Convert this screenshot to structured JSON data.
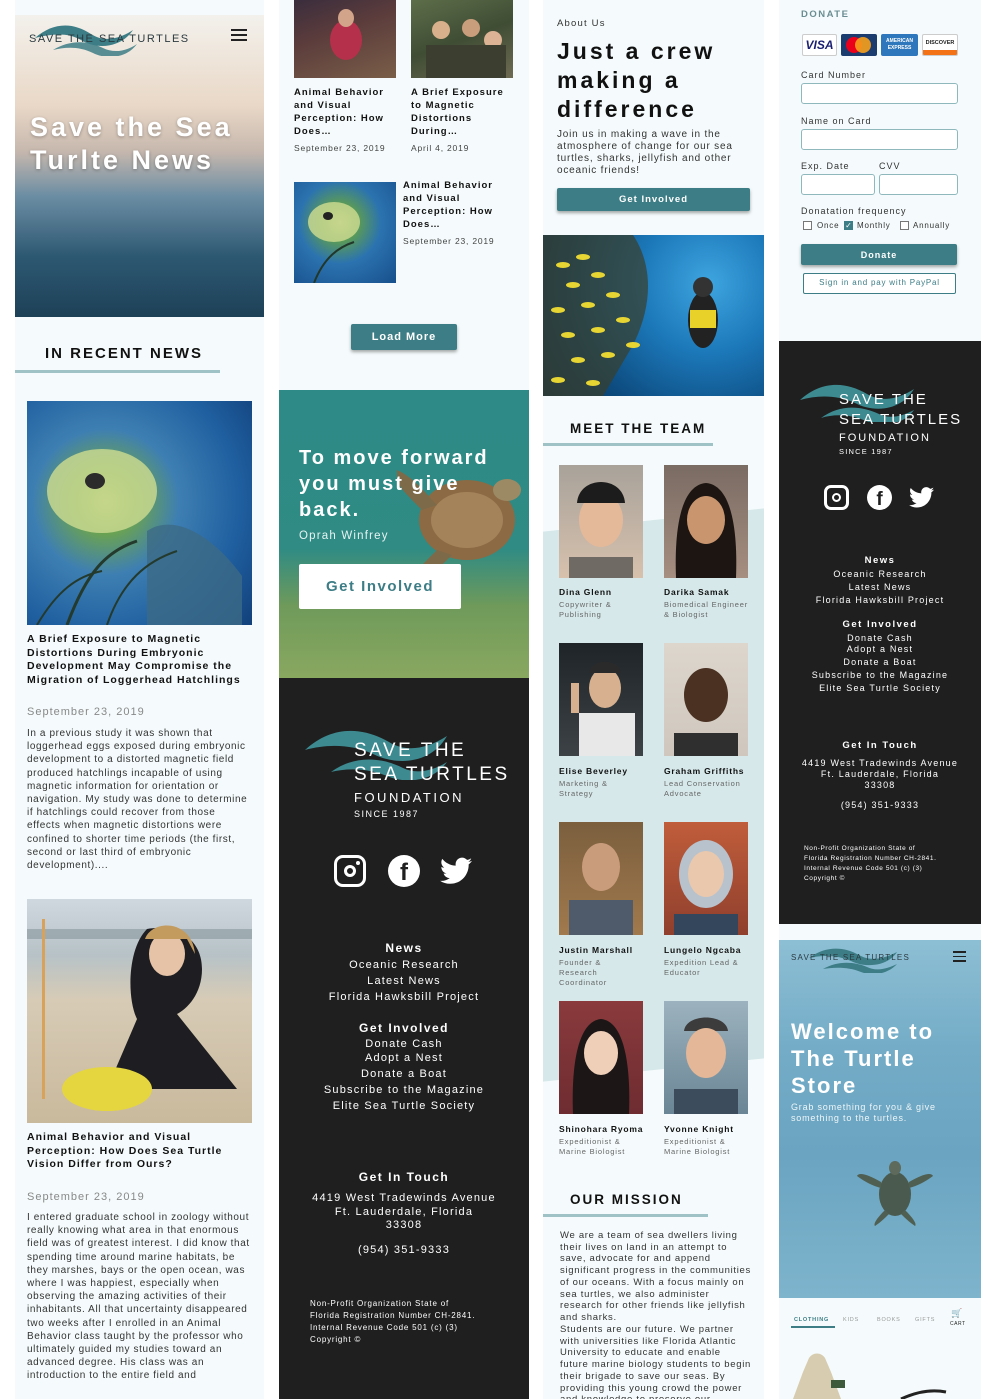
{
  "colors": {
    "accent": "#3d7d86",
    "footer_bg": "#1f1f1f",
    "light_bg": "#f5fbfc"
  },
  "col1": {
    "logo": "SAVE THE SEA TURTLES",
    "hero_title": "Save the Sea Turlte News",
    "section_title": "IN RECENT NEWS",
    "articles": [
      {
        "title": "A Brief Exposure to Magnetic Distortions During Embryonic Development May Compromise the Migration of Loggerhead Hatchlings",
        "date": "September 23, 2019",
        "body": "In a previous study it was shown that loggerhead eggs exposed during embryonic development to a distorted magnetic field produced hatchlings incapable of using magnetic information for orientation or navigation. My study was done to determine if hatchlings could recover from those effects when magnetic distortions were confined to shorter time periods (the first, second or last third of embryonic development)...."
      },
      {
        "title": "Animal Behavior and Visual Perception: How Does Sea Turtle Vision Differ from Ours?",
        "date": "September 23, 2019",
        "body": "I entered graduate school in zoology without really knowing what area in that enormous field was of greatest interest. I did know that spending time around marine habitats, be they marshes, bays or the open ocean, was where I was happiest, especially when observing the amazing activities of their inhabitants. All that uncertainty disappeared two weeks after I enrolled in an Animal Behavior class taught by the professor who ultimately guided my studies toward an advanced degree. His class was an introduction to the entire field and"
      }
    ]
  },
  "col2": {
    "cards": [
      {
        "title": "Animal Behavior and Visual Perception: How Does…",
        "date": "September 23, 2019"
      },
      {
        "title": "A Brief Exposure to Magnetic Distortions During…",
        "date": "April 4, 2019"
      },
      {
        "title": "Animal Behavior and Visual Perception: How Does…",
        "date": "September 23, 2019"
      }
    ],
    "load_more": "Load More",
    "quote": "To move forward you must give back.",
    "quote_author": "Oprah Winfrey",
    "cta": "Get Involved"
  },
  "footer": {
    "logo_line1": "SAVE THE",
    "logo_line2": "SEA TURTLES",
    "logo_line3": "FOUNDATION",
    "logo_line4": "SINCE 1987",
    "news_h": "News",
    "news_links": [
      "Oceanic Research",
      "Latest News",
      "Florida Hawksbill Project"
    ],
    "involved_h": "Get Involved",
    "involved_links": [
      "Donate Cash",
      "Adopt a Nest",
      "Donate a Boat",
      "Subscribe to the Magazine",
      "Elite Sea Turtle Society"
    ],
    "touch_h": "Get In Touch",
    "address1": "4419 West Tradewinds Avenue",
    "address2": "Ft. Lauderdale, Florida",
    "address3": "33308",
    "phone": "(954) 351-9333",
    "legal1": "Non-Profit Organization State of",
    "legal2": "Florida Registration Number CH-2841.",
    "legal3": "Internal Revenue Code 501 (c) (3)",
    "legal4": "Copyright ©",
    "social": [
      "instagram-icon",
      "facebook-icon",
      "twitter-icon"
    ]
  },
  "col3": {
    "about_label": "About Us",
    "about_title": "Just a crew making a difference",
    "about_text": "Join us in making a wave in the atmosphere of change for our sea turtles, sharks, jellyfish and other oceanic friends!",
    "cta": "Get Involved",
    "team_title": "MEET THE TEAM",
    "team": [
      {
        "name": "Dina Glenn",
        "role": "Copywriter & Publishing"
      },
      {
        "name": "Darika Samak",
        "role": "Biomedical Engineer & Biologist"
      },
      {
        "name": "Elise Beverley",
        "role": "Marketing & Strategy"
      },
      {
        "name": "Graham Griffiths",
        "role": "Lead Conservation Advocate"
      },
      {
        "name": "Justin Marshall",
        "role": "Founder & Research Coordinator"
      },
      {
        "name": "Lungelo Ngcaba",
        "role": "Expedition Lead & Educator"
      },
      {
        "name": "Shinohara Ryoma",
        "role": "Expeditionist & Marine Biologist"
      },
      {
        "name": "Yvonne Knight",
        "role": "Expeditionist & Marine Biologist"
      }
    ],
    "mission_title": "OUR MISSION",
    "mission_text": "We are a team of sea dwellers living their lives on land in an attempt to save, advocate for and append significant progress in the communities of our oceans. With a focus mainly on sea turtles, we also administer research for other friends like jellyfish and sharks.",
    "mission_text2": "Students are our future. We partner with universities like Florida Atlantic University to educate and enable future marine biology students to begin their brigade to save our seas. By providing this young crowd the power and knowledge to preserve our"
  },
  "col4": {
    "donate_title": "DONATE",
    "cards": [
      "VISA",
      "MasterCard",
      "AMERICAN EXPRESS",
      "DISCOVER"
    ],
    "card_number": "Card Number",
    "name_on_card": "Name on Card",
    "exp": "Exp. Date",
    "cvv": "CVV",
    "frequency": "Donatation frequency",
    "freq_options": [
      "Once",
      "Monthly",
      "Annually"
    ],
    "donate_btn": "Donate",
    "paypal_btn": "Sign in and pay with PayPal",
    "store_logo": "SAVE THE SEA TURTLES",
    "store_title": "Welcome to The Turtle Store",
    "store_sub": "Grab something for you & give something to the turtles.",
    "store_tabs": [
      "CLOTHING",
      "KIDS",
      "BOOKS",
      "GIFTS"
    ],
    "cart": "CART"
  }
}
